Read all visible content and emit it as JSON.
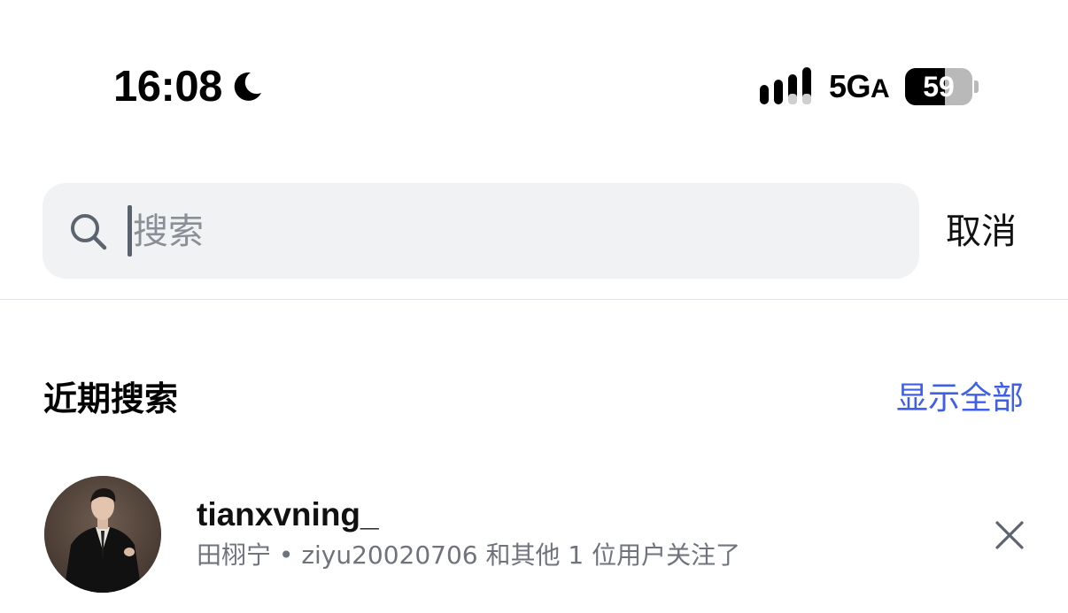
{
  "status_bar": {
    "time": "16:08",
    "moon_icon": "moon-icon",
    "network": "5G",
    "network_suffix": "A",
    "battery_percent": "59",
    "battery_level": 0.59
  },
  "search": {
    "placeholder": "搜索",
    "value": "",
    "icon": "search-icon",
    "cancel_label": "取消"
  },
  "recent": {
    "title": "近期搜索",
    "show_all_label": "显示全部",
    "items": [
      {
        "username": "tianxvning_",
        "subtitle": "田栩宁 • ziyu20020706 和其他 1 位用户关注了",
        "avatar": "avatar",
        "remove_icon": "close-icon"
      }
    ]
  },
  "colors": {
    "accent": "#3f5fe8",
    "search_bg": "#f1f2f4",
    "secondary_text": "#6e737c"
  }
}
